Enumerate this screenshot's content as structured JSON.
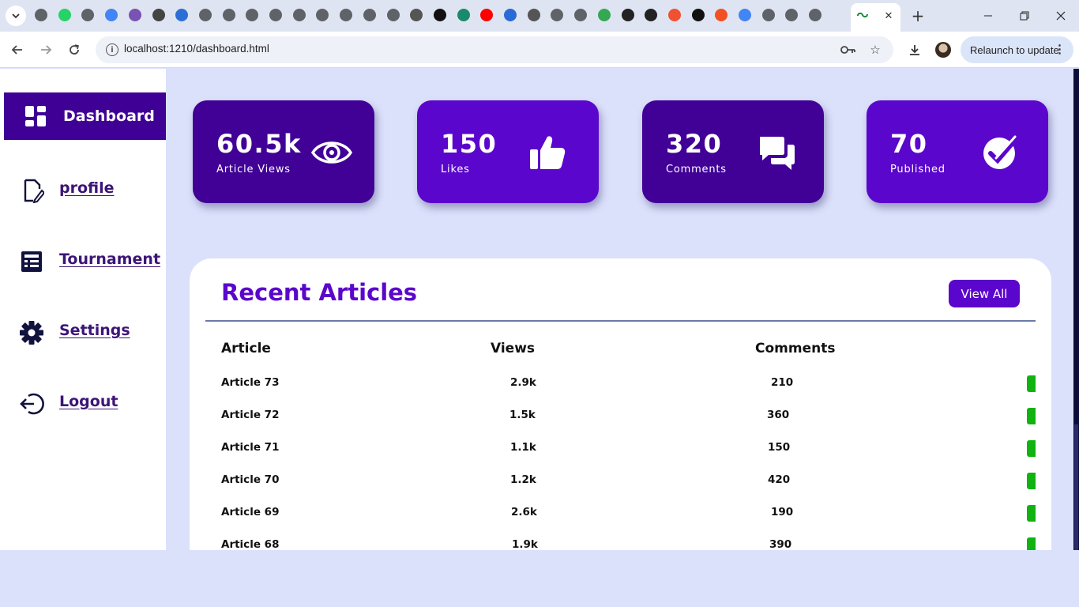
{
  "browser": {
    "url": "localhost:1210/dashboard.html",
    "relaunch_label": "Relaunch to update",
    "tab_favicons": [
      "chrome",
      "whatsapp",
      "chrome",
      "google",
      "bootstrap",
      "openai",
      "docs",
      "globe",
      "globe",
      "globe",
      "globe",
      "globe",
      "globe",
      "globe",
      "globe",
      "globe",
      "code",
      "figma",
      "webflow",
      "youtube",
      "flag",
      "code",
      "globe",
      "globe",
      "maps",
      "github",
      "github",
      "git",
      "dark",
      "microsoft",
      "google",
      "globe",
      "globe",
      "globe",
      "link"
    ]
  },
  "sidebar": {
    "active": {
      "label": "Dashboard",
      "icon": "grid-icon"
    },
    "items": [
      {
        "label": "profile",
        "icon": "edit-doc-icon"
      },
      {
        "label": "Tournament",
        "icon": "newspaper-icon"
      },
      {
        "label": "Settings",
        "icon": "gear-icon"
      },
      {
        "label": "Logout",
        "icon": "logout-icon"
      }
    ]
  },
  "stats": [
    {
      "value": "60.5k",
      "label": "Article Views",
      "icon": "eye-icon"
    },
    {
      "value": "150",
      "label": "Likes",
      "icon": "thumbs-up-icon"
    },
    {
      "value": "320",
      "label": "Comments",
      "icon": "comments-icon"
    },
    {
      "value": "70",
      "label": "Published",
      "icon": "check-circle-icon"
    }
  ],
  "articles": {
    "title": "Recent Articles",
    "view_all": "View All",
    "headers": [
      "Article",
      "Views",
      "Comments"
    ],
    "rows": [
      {
        "article": "Article 73",
        "views": "2.9k",
        "comments": "210"
      },
      {
        "article": "Article 72",
        "views": "1.5k",
        "comments": "360"
      },
      {
        "article": "Article 71",
        "views": "1.1k",
        "comments": "150"
      },
      {
        "article": "Article 70",
        "views": "1.2k",
        "comments": "420"
      },
      {
        "article": "Article 69",
        "views": "2.6k",
        "comments": "190"
      },
      {
        "article": "Article 68",
        "views": "1.9k",
        "comments": "390"
      }
    ]
  },
  "colors": {
    "accent": "#5b06cc",
    "accent_dark": "#410197",
    "page_bg": "#dbe1fb",
    "status_green": "#11b311"
  }
}
